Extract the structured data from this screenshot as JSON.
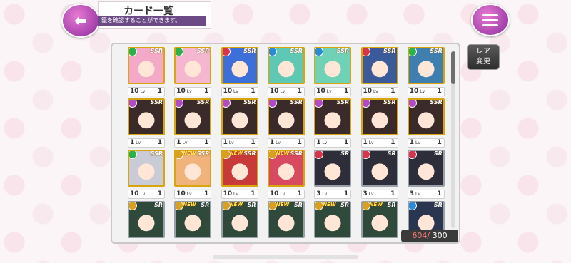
{
  "header": {
    "title": "カード一覧",
    "subtitle": "籠を確認することができます。"
  },
  "side": {
    "rare_change_label_1": "レア",
    "rare_change_label_2": "変更"
  },
  "counter": {
    "current": "604/",
    "max": "300"
  },
  "colors": {
    "ssr_border": "#d9a50f",
    "sr_border": "#9aa0a8",
    "accent": "#8a2a9c"
  },
  "cards": [
    {
      "rarity": "SSR",
      "lv": "10",
      "stars": "1",
      "art": "#f4a9c8",
      "attr": "#2bb24c",
      "is_new": false
    },
    {
      "rarity": "SSR",
      "lv": "10",
      "stars": "1",
      "art": "#f5b6cf",
      "attr": "#2bb24c",
      "is_new": false
    },
    {
      "rarity": "SSR",
      "lv": "10",
      "stars": "1",
      "art": "#3d6fd8",
      "attr": "#d8344a",
      "is_new": false
    },
    {
      "rarity": "SSR",
      "lv": "10",
      "stars": "1",
      "art": "#5fc8b4",
      "attr": "#2a8ad8",
      "is_new": false
    },
    {
      "rarity": "SSR",
      "lv": "10",
      "stars": "1",
      "art": "#6fd2b6",
      "attr": "#2a8ad8",
      "is_new": false
    },
    {
      "rarity": "SSR",
      "lv": "10",
      "stars": "1",
      "art": "#3b5a9a",
      "attr": "#d8344a",
      "is_new": false
    },
    {
      "rarity": "SSR",
      "lv": "10",
      "stars": "1",
      "art": "#3f7fb0",
      "attr": "#2bb24c",
      "is_new": false
    },
    {
      "rarity": "SSR",
      "lv": "1",
      "stars": "1",
      "art": "#3a2a2a",
      "attr": "#b04ac8",
      "is_new": false
    },
    {
      "rarity": "SSR",
      "lv": "1",
      "stars": "1",
      "art": "#3a2a2a",
      "attr": "#b04ac8",
      "is_new": false
    },
    {
      "rarity": "SSR",
      "lv": "1",
      "stars": "1",
      "art": "#3a2a2a",
      "attr": "#b04ac8",
      "is_new": false
    },
    {
      "rarity": "SSR",
      "lv": "1",
      "stars": "1",
      "art": "#3a2a2a",
      "attr": "#b04ac8",
      "is_new": false
    },
    {
      "rarity": "SSR",
      "lv": "1",
      "stars": "1",
      "art": "#3a2a2a",
      "attr": "#b04ac8",
      "is_new": false
    },
    {
      "rarity": "SSR",
      "lv": "1",
      "stars": "1",
      "art": "#3a2a2a",
      "attr": "#b04ac8",
      "is_new": false
    },
    {
      "rarity": "SSR",
      "lv": "1",
      "stars": "1",
      "art": "#3a2a2a",
      "attr": "#b04ac8",
      "is_new": false
    },
    {
      "rarity": "SSR",
      "lv": "10",
      "stars": "1",
      "art": "#c9ccd6",
      "attr": "#2bb24c",
      "is_new": false
    },
    {
      "rarity": "SSR",
      "lv": "10",
      "stars": "1",
      "art": "#f1b37c",
      "attr": "#d8a020",
      "is_new": true
    },
    {
      "rarity": "SSR",
      "lv": "10",
      "stars": "1",
      "art": "#c83a3a",
      "attr": "#d8a020",
      "is_new": true
    },
    {
      "rarity": "SSR",
      "lv": "10",
      "stars": "1",
      "art": "#d84a62",
      "attr": "#d8a020",
      "is_new": true
    },
    {
      "rarity": "SR",
      "lv": "3",
      "stars": "1",
      "art": "#2e2e3a",
      "attr": "#d8344a",
      "is_new": false
    },
    {
      "rarity": "SR",
      "lv": "3",
      "stars": "1",
      "art": "#2e2e3a",
      "attr": "#d8344a",
      "is_new": false
    },
    {
      "rarity": "SR",
      "lv": "3",
      "stars": "1",
      "art": "#2e2e3a",
      "attr": "#d8344a",
      "is_new": false
    },
    {
      "rarity": "SR",
      "lv": "",
      "stars": "",
      "art": "#2f4a3a",
      "attr": "#d8a020",
      "is_new": false
    },
    {
      "rarity": "SR",
      "lv": "",
      "stars": "",
      "art": "#2f4a3a",
      "attr": "#d8a020",
      "is_new": true
    },
    {
      "rarity": "SR",
      "lv": "",
      "stars": "",
      "art": "#2f4a3a",
      "attr": "#d8a020",
      "is_new": true
    },
    {
      "rarity": "SR",
      "lv": "",
      "stars": "",
      "art": "#2f4a3a",
      "attr": "#d8a020",
      "is_new": true
    },
    {
      "rarity": "SR",
      "lv": "",
      "stars": "",
      "art": "#2f4a3a",
      "attr": "#d8a020",
      "is_new": true
    },
    {
      "rarity": "SR",
      "lv": "",
      "stars": "",
      "art": "#2f4a3a",
      "attr": "#d8a020",
      "is_new": true
    },
    {
      "rarity": "SR",
      "lv": "",
      "stars": "",
      "art": "#2a3550",
      "attr": "#2a8ad8",
      "is_new": false
    }
  ],
  "new_label": "NEW",
  "lv_suffix": "Lv"
}
